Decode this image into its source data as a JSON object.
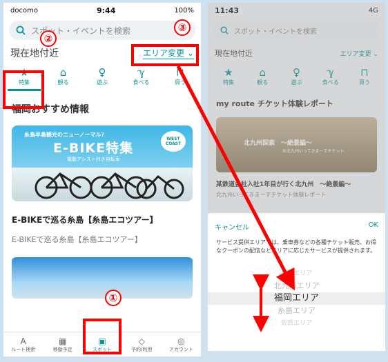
{
  "left": {
    "status": {
      "carrier": "docomo",
      "time": "9:44",
      "battery": "100%"
    },
    "search_placeholder": "スポット・イベントを検索",
    "location_label": "現在地付近",
    "area_button": "エリア変更",
    "categories": [
      {
        "label": "特集",
        "icon": "★"
      },
      {
        "label": "観る",
        "icon": "⌂"
      },
      {
        "label": "遊ぶ",
        "icon": "♀"
      },
      {
        "label": "食べる",
        "icon": "ℽ"
      },
      {
        "label": "買う",
        "icon": "⊓"
      }
    ],
    "section_title": "福岡おすすめ情報",
    "banner": {
      "top": "糸島半島観光のニューノーマル？",
      "big": "E-BIKE特集",
      "sub": "電動アシスト付き自転車",
      "badge": "WEST COAST"
    },
    "item_title": "E-BIKEで巡る糸島【糸島エコツアー】",
    "item_sub": "E-BIKEで巡る糸島【糸島エコツアー】",
    "tabs": [
      {
        "label": "ルート検索",
        "icon": "A"
      },
      {
        "label": "移動予定",
        "icon": "▦"
      },
      {
        "label": "スポット",
        "icon": "▣"
      },
      {
        "label": "予約/利用",
        "icon": "◇"
      },
      {
        "label": "アカウント",
        "icon": "◎"
      }
    ],
    "markers": [
      "①",
      "②",
      "③"
    ]
  },
  "right": {
    "status": {
      "time": "11:43",
      "network": "4G"
    },
    "search_placeholder": "スポット・イベントを検索",
    "location_label": "現在地付近",
    "area_button": "エリア変更",
    "section_title": "my route チケット体験レポート",
    "photo_text": "北九州探索　～絶景編～",
    "photo_sub": "お北九州いってきまーすチケット",
    "report_title": "某鉄道会社入社1年目が行く北九州　～絶景編～",
    "report_sub": "北九州いってきまーすチケット体験レポート",
    "sheet": {
      "cancel": "キャンセル",
      "ok": "OK",
      "desc": "サービス提供エリアでは、乗車券などの各種チケット販売、お得なクーポンの配信などエリアに応じたサービスが提供されます。",
      "options": [
        "愛知エリア",
        "北九州エリア",
        "福岡エリア",
        "糸島エリア",
        "佐賀エリア"
      ],
      "selected": "福岡エリア"
    }
  },
  "colors": {
    "accent": "#0a9396",
    "annotation": "#ff0000"
  }
}
